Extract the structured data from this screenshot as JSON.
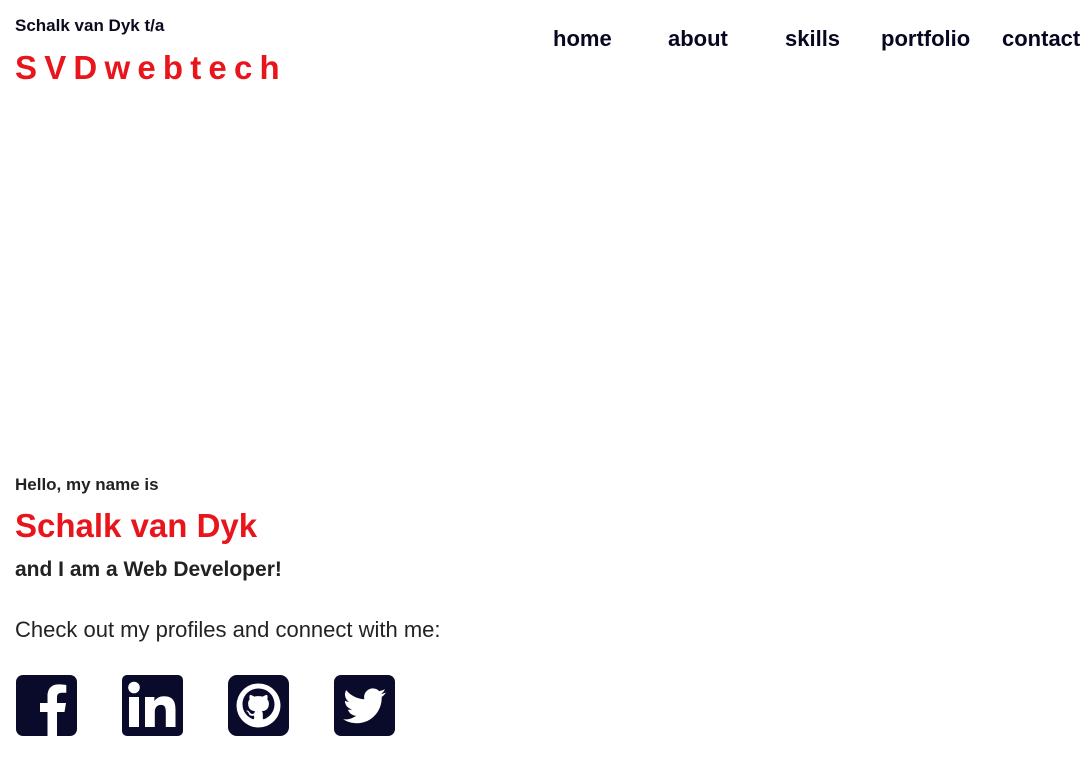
{
  "brand": {
    "subtitle": "Schalk van Dyk t/a",
    "logo_text": "SVDwebtech"
  },
  "nav": {
    "items": [
      {
        "label": "home"
      },
      {
        "label": "about"
      },
      {
        "label": "skills"
      },
      {
        "label": "portfolio"
      },
      {
        "label": "contact"
      }
    ]
  },
  "hero": {
    "greeting": "Hello, my name is",
    "name": "Schalk van Dyk",
    "role": "and I am a Web Developer!",
    "connect_text": "Check out my profiles and connect with me:"
  },
  "socials": [
    {
      "icon": "facebook-icon"
    },
    {
      "icon": "linkedin-icon"
    },
    {
      "icon": "github-icon"
    },
    {
      "icon": "twitter-icon"
    }
  ],
  "colors": {
    "accent": "#e8161c",
    "nav_text": "#070722",
    "icon_bg": "#0a0a2a",
    "body_text": "#222222"
  }
}
